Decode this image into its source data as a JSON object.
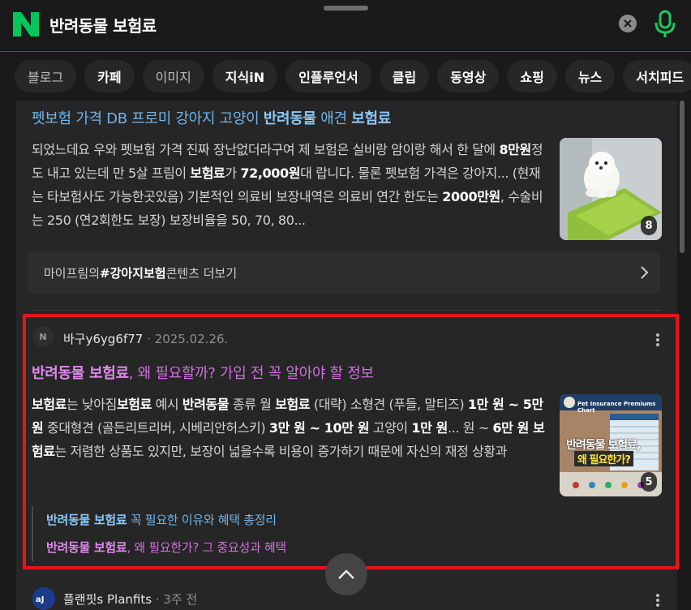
{
  "header": {
    "query": "반려동물 보험료",
    "logo": "N",
    "icons": {
      "clear": "clear-icon",
      "mic": "mic-icon"
    },
    "colors": {
      "brand": "#03c75a"
    }
  },
  "tabs": [
    {
      "label": "블로그"
    },
    {
      "label": "카페"
    },
    {
      "label": "이미지"
    },
    {
      "label": "지식iN"
    },
    {
      "label": "인플루언서"
    },
    {
      "label": "클립"
    },
    {
      "label": "동영상"
    },
    {
      "label": "쇼핑"
    },
    {
      "label": "뉴스"
    },
    {
      "label": "서치피드"
    }
  ],
  "post1": {
    "title_a": "펫보험 가격 DB 프로미 강아지 고양이 ",
    "title_b": "반려동물",
    "title_c": " 애견 ",
    "title_d": "보험료",
    "snippet": [
      {
        "t": "되었느데요 우와 펫보험 가격 진짜 장난없더라구여 제 보험은 실비랑 암이랑 해서 한 달에 ",
        "b": false
      },
      {
        "t": "8만원",
        "b": true
      },
      {
        "t": "정도 내고 있는데 만 5살 프림이 ",
        "b": false
      },
      {
        "t": "보험료",
        "b": true
      },
      {
        "t": "가 ",
        "b": false
      },
      {
        "t": "72,000원",
        "b": true
      },
      {
        "t": "대 랍니다. 물론 펫보험 가격은 강아지... (현재는 타보험사도 가능한곳있음) 기본적인 의료비 보장내역은 의료비 연간 한도는 ",
        "b": false
      },
      {
        "t": "2000만원",
        "b": true
      },
      {
        "t": ", 수술비는 250 (연2회한도 보장) 보장비율을 50, 70, 80...",
        "b": false
      }
    ],
    "thumb_count": "8",
    "more_prefix": "마이프림의 ",
    "more_tag": "#강아지보험",
    "more_suffix": " 콘텐츠 더보기"
  },
  "post2": {
    "author_icon": "N",
    "author": "바구y6yg6f77",
    "date": "2025.02.26.",
    "title_a": "반려동물 보험료",
    "title_b": ", 왜 필요할까? 가입 전 꼭 알아야 할 정보",
    "snippet": [
      {
        "t": "보험료",
        "b": true
      },
      {
        "t": "는 낮아짐",
        "b": false
      },
      {
        "t": "보험료",
        "b": true
      },
      {
        "t": " 예시 ",
        "b": false
      },
      {
        "t": "반려동물",
        "b": true
      },
      {
        "t": " 종류 월 ",
        "b": false
      },
      {
        "t": "보험료",
        "b": true
      },
      {
        "t": " (대략) 소형견 (푸들, 말티즈) ",
        "b": false
      },
      {
        "t": "1만 원 ~ 5만 원",
        "b": true
      },
      {
        "t": " 중대형견 (골든리트리버, 시베리안허스키) ",
        "b": false
      },
      {
        "t": "3만 원 ~ 10만 원",
        "b": true
      },
      {
        "t": " 고양이 ",
        "b": false
      },
      {
        "t": "1만 원",
        "b": true
      },
      {
        "t": "... 원 ~ ",
        "b": false
      },
      {
        "t": "6만 원 보험료",
        "b": true
      },
      {
        "t": "는 저렴한 상품도 있지만, 보장이 넓을수록 비용이 증가하기 때문에 자신의 재정 상황과",
        "b": false
      }
    ],
    "thumb_chart_title": "Pet Insurance Premiums Chart",
    "thumb_caption_1": "반려동물 보험료,",
    "thumb_caption_2": "왜 필요한가?",
    "thumb_count": "5",
    "sublink1_a": "반려동물 보험료",
    "sublink1_b": " 꼭 필요한 이유와 혜택 총정리",
    "sublink2_a": "반려동물 보험료",
    "sublink2_b": ", 왜 필요한가? 그 중요성과 혜택",
    "highlight_color": "#e8141a"
  },
  "post3": {
    "author_icon": "PLANFITS",
    "author": "플랜핏s Planfits",
    "date": "3주 전"
  }
}
